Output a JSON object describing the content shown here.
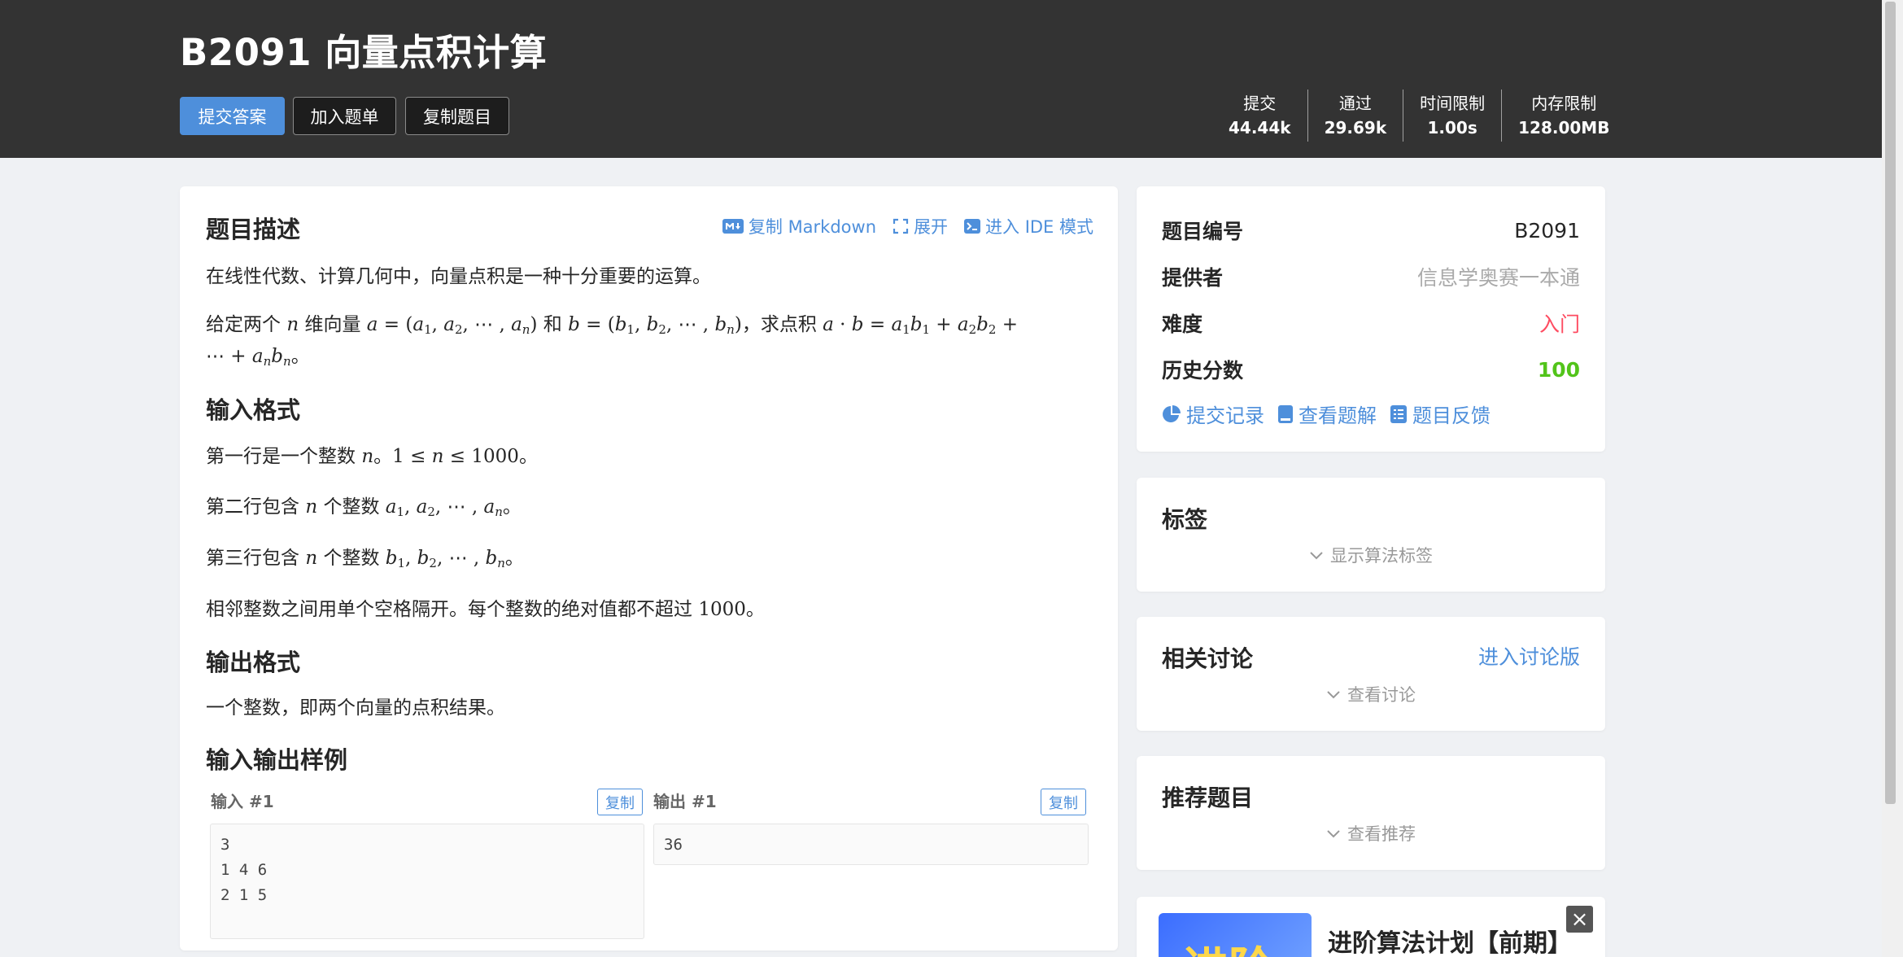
{
  "header": {
    "title": "B2091 向量点积计算",
    "buttons": {
      "submit": "提交答案",
      "add_list": "加入题单",
      "copy_problem": "复制题目"
    },
    "stats": [
      {
        "label": "提交",
        "value": "44.44k"
      },
      {
        "label": "通过",
        "value": "29.69k"
      },
      {
        "label": "时间限制",
        "value": "1.00s"
      },
      {
        "label": "内存限制",
        "value": "128.00MB"
      }
    ]
  },
  "toolbar": {
    "copy_markdown": "复制 Markdown",
    "expand": "展开",
    "ide_mode": "进入 IDE 模式"
  },
  "problem": {
    "desc_title": "题目描述",
    "desc_p1": "在线性代数、计算几何中，向量点积是一种十分重要的运算。",
    "desc_p2a": "给定两个",
    "desc_p2b": "维向量",
    "desc_p2c": "和",
    "desc_p2d": "，求点积",
    "input_title": "输入格式",
    "input_l1a": "第一行是一个整数",
    "input_l2a": "第二行包含",
    "input_l2b": "个整数",
    "input_l3a": "第三行包含",
    "input_l3b": "个整数",
    "input_l4a": "相邻整数之间用单个空格隔开。每个整数的绝对值都不超过",
    "input_l4b": "1000",
    "output_title": "输出格式",
    "output_p1": "一个整数，即两个向量的点积结果。",
    "samples_title": "输入输出样例",
    "sample_in_label": "输入 #1",
    "sample_out_label": "输出 #1",
    "copy_label": "复制",
    "sample_in": "3\n1 4 6\n2 1 5",
    "sample_out": "36"
  },
  "info": {
    "rows": [
      {
        "key": "题目编号",
        "value": "B2091",
        "color": "#262626"
      },
      {
        "key": "提供者",
        "value": "信息学奥赛一本通",
        "color": "#aaaaaa"
      },
      {
        "key": "难度",
        "value": "入门",
        "color": "#fe4c61"
      },
      {
        "key": "历史分数",
        "value": "100",
        "color": "#52c41a"
      }
    ],
    "links": {
      "records": "提交记录",
      "solutions": "查看题解",
      "feedback": "题目反馈"
    }
  },
  "tags": {
    "title": "标签",
    "expand": "显示算法标签"
  },
  "discuss": {
    "title": "相关讨论",
    "enter": "进入讨论版",
    "expand": "查看讨论"
  },
  "recommend": {
    "title": "推荐题目",
    "expand": "查看推荐"
  },
  "ad": {
    "image_text": "进阶",
    "title": "进阶算法计划【前期】",
    "close": "×"
  }
}
